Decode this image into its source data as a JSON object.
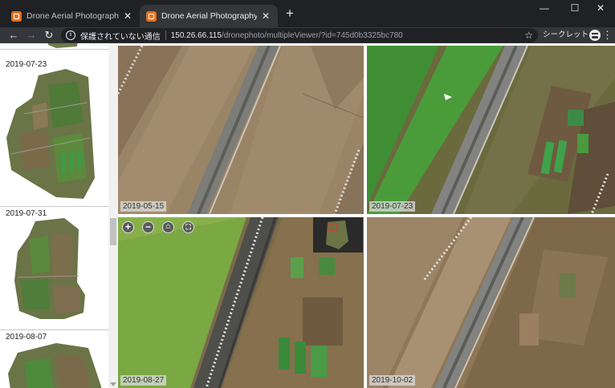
{
  "browser": {
    "tabs": [
      {
        "title": "Drone Aerial Photography Mana",
        "active": false
      },
      {
        "title": "Drone Aerial Photography Mana",
        "active": true
      }
    ],
    "new_tab_label": "+",
    "controls": {
      "minimize": "—",
      "maximize": "☐",
      "close": "✕"
    },
    "address": {
      "security_text": "保護されていない通信",
      "host": "150.26.66.115",
      "path": "/dronephoto/multipleViewer/?id=745d0b3325bc780"
    },
    "incognito_label": "シークレット"
  },
  "sidebar": {
    "thumbnails": [
      {
        "date": ""
      },
      {
        "date": "2019-07-23"
      },
      {
        "date": "2019-07-31"
      },
      {
        "date": "2019-08-07"
      }
    ]
  },
  "viewer": {
    "panes": [
      {
        "date": "2019-05-15"
      },
      {
        "date": "2019-07-23"
      },
      {
        "date": "2019-08-27"
      },
      {
        "date": "2019-10-02"
      }
    ],
    "map_controls": [
      {
        "icon": "zoom-in-icon",
        "glyph": "+"
      },
      {
        "icon": "zoom-out-icon",
        "glyph": "−"
      },
      {
        "icon": "home-icon",
        "glyph": "⌂"
      },
      {
        "icon": "fullscreen-icon",
        "glyph": "⛶"
      }
    ]
  }
}
